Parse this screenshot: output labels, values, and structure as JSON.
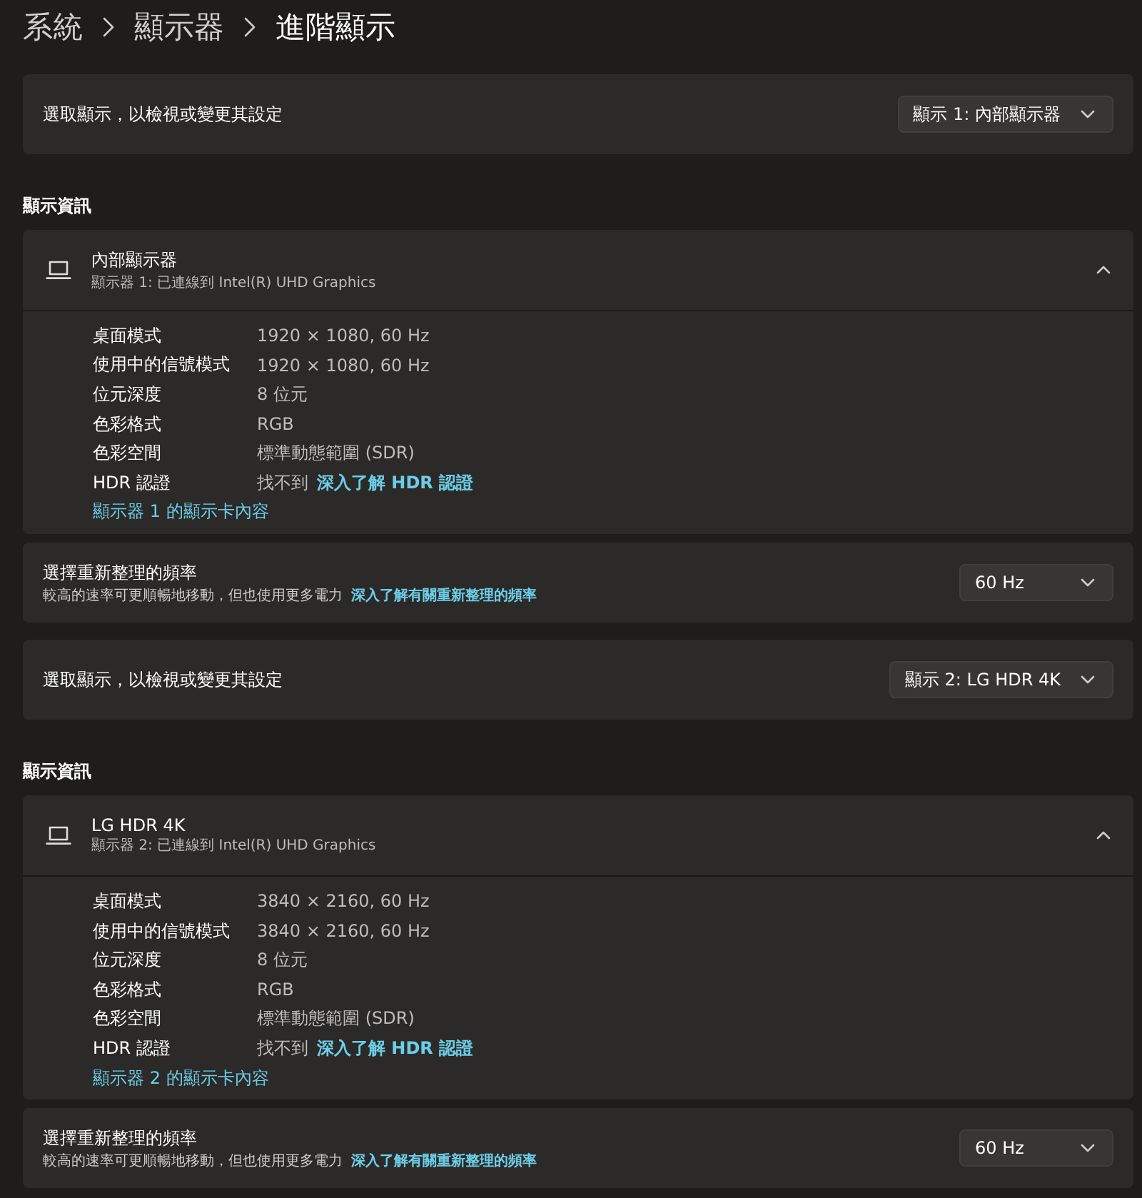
{
  "breadcrumb": [
    "系統",
    "顯示器",
    "進階顯示"
  ],
  "displays": [
    {
      "select_label": "選取顯示，以檢視或變更其設定",
      "select_value": "顯示 1: 內部顯示器",
      "section_title": "顯示資訊",
      "monitor": {
        "name": "內部顯示器",
        "subtitle": "顯示器 1: 已連線到 Intel(R) UHD Graphics",
        "expanded": true
      },
      "properties": [
        {
          "label": "桌面模式",
          "value": "1920 × 1080, 60 Hz"
        },
        {
          "label": "使用中的信號模式",
          "value": "1920 × 1080, 60 Hz"
        },
        {
          "label": "位元深度",
          "value": "8 位元"
        },
        {
          "label": "色彩格式",
          "value": "RGB"
        },
        {
          "label": "色彩空間",
          "value": "標準動態範圍 (SDR)"
        },
        {
          "label": "HDR 認證",
          "value": "找不到",
          "link": "深入了解 HDR 認證"
        }
      ],
      "adapter_link": "顯示器 1 的顯示卡內容",
      "refresh": {
        "title": "選擇重新整理的頻率",
        "description": "較高的速率可更順暢地移動，但也使用更多電力",
        "link": "深入了解有關重新整理的頻率",
        "value": "60 Hz"
      }
    },
    {
      "select_label": "選取顯示，以檢視或變更其設定",
      "select_value": "顯示 2: LG HDR 4K",
      "section_title": "顯示資訊",
      "monitor": {
        "name": "LG HDR 4K",
        "subtitle": "顯示器 2: 已連線到 Intel(R) UHD Graphics",
        "expanded": true
      },
      "properties": [
        {
          "label": "桌面模式",
          "value": "3840 × 2160, 60 Hz"
        },
        {
          "label": "使用中的信號模式",
          "value": "3840 × 2160, 60 Hz"
        },
        {
          "label": "位元深度",
          "value": "8 位元"
        },
        {
          "label": "色彩格式",
          "value": "RGB"
        },
        {
          "label": "色彩空間",
          "value": "標準動態範圍 (SDR)"
        },
        {
          "label": "HDR 認證",
          "value": "找不到",
          "link": "深入了解 HDR 認證"
        }
      ],
      "adapter_link": "顯示器 2 的顯示卡內容",
      "refresh": {
        "title": "選擇重新整理的頻率",
        "description": "較高的速率可更順暢地移動，但也使用更多電力",
        "link": "深入了解有關重新整理的頻率",
        "value": "60 Hz"
      }
    }
  ]
}
